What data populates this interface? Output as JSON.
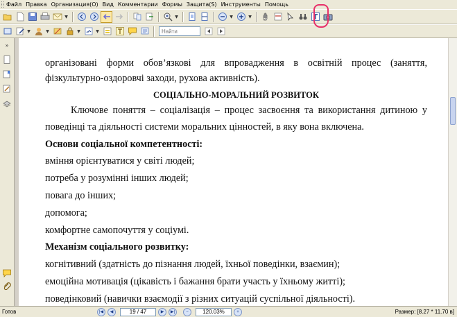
{
  "menu": [
    "Файл",
    "Правка",
    "Организация(O)",
    "Вид",
    "Комментарии",
    "Формы",
    "Защита(S)",
    "Инструменты",
    "Помощь"
  ],
  "toolbar": {
    "find_placeholder": "Найти"
  },
  "document": {
    "lines": [
      {
        "text": "організовані форми обов’язкові для впровадження в освітній процес (заняття,",
        "style": "justify"
      },
      {
        "text": "фізкультурно-оздоровчі заходи, рухова активність).",
        "style": "plain"
      },
      {
        "text": "СОЦІАЛЬНО-МОРАЛЬНИЙ  РОЗВИТОК",
        "style": "heading"
      },
      {
        "text": "Ключове поняття – соціалізація – процес засвоєння та використання дитиною у",
        "style": "indent-justify"
      },
      {
        "text": "поведінці та діяльності системи моральних цінностей, в яку вона включена.",
        "style": "plain"
      },
      {
        "text": "Основи соціальної компетентності:",
        "style": "bold"
      },
      {
        "text": "вміння орієнтуватися у світі людей;",
        "style": "plain"
      },
      {
        "text": "потреба у розумінні інших людей;",
        "style": "plain"
      },
      {
        "text": "повага до інших;",
        "style": "plain"
      },
      {
        "text": "допомога;",
        "style": "plain"
      },
      {
        "text": "комфортне самопочуття у соціумі.",
        "style": "plain"
      },
      {
        "text": "Механізм соціального розвитку:",
        "style": "bold"
      },
      {
        "text": "когнітивний (здатність до пізнання людей, їхньої поведінки, взаємин);",
        "style": "plain"
      },
      {
        "text": "емоційна мотивація (цікавість і бажання брати участь у їхньому житті);",
        "style": "plain"
      },
      {
        "text": "поведінковий (навички взаємодії з різних ситуацій суспільної діяльності).",
        "style": "plain"
      }
    ]
  },
  "status": {
    "ready": "Готов",
    "page": "19 / 47",
    "zoom": "120.03%",
    "size": "Размер: [8.27 * 11.70 в]"
  },
  "colors": {
    "highlight_circle": "#e8306a",
    "chrome": "#ece9d8",
    "nav_blue": "#7d96c6"
  }
}
